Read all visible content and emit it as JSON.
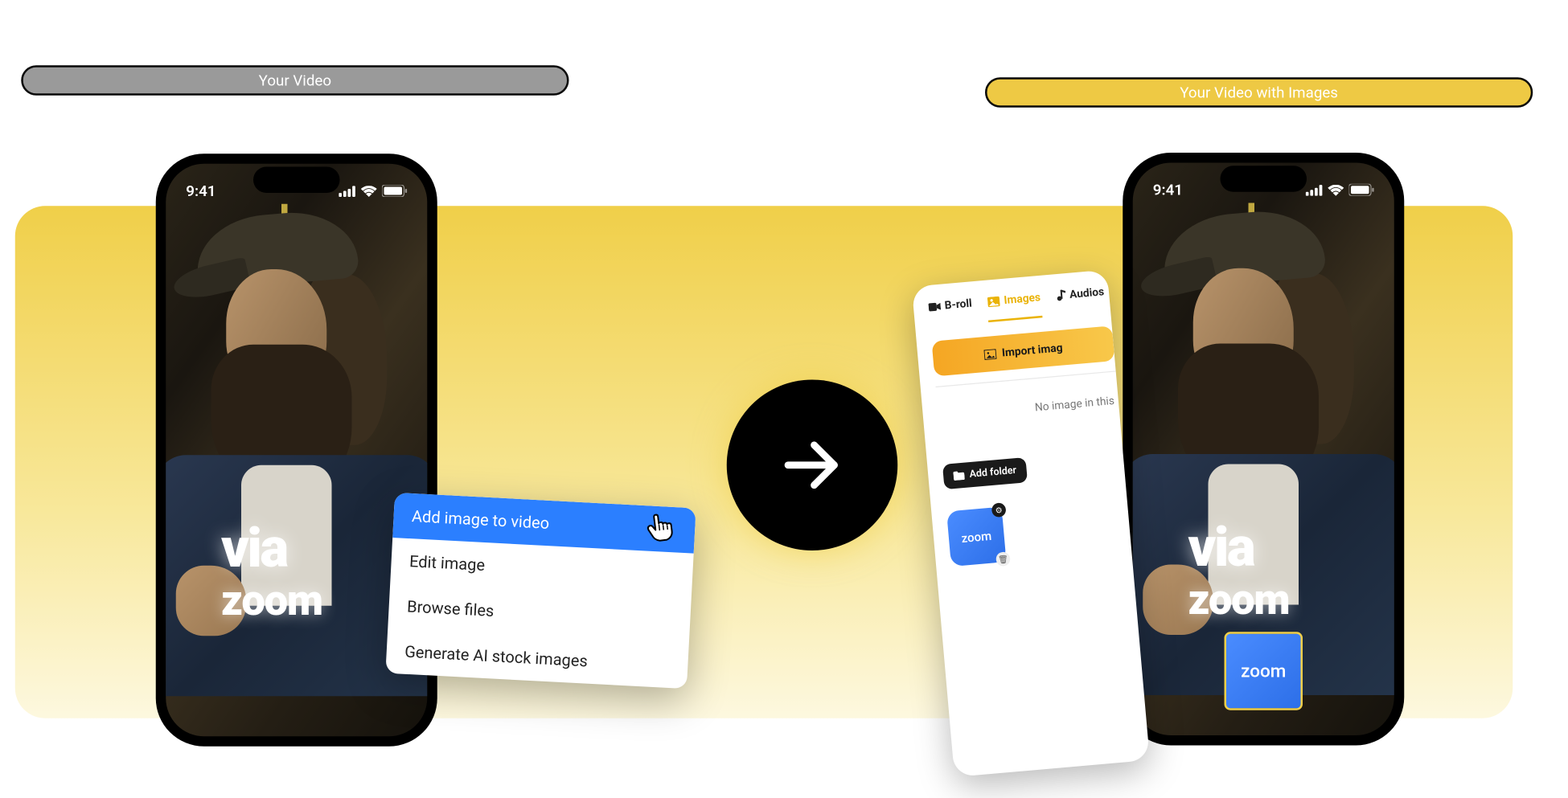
{
  "labels": {
    "left": "Your Video",
    "right": "Your Video with Images"
  },
  "phone": {
    "time": "9:41",
    "overlay_line1": "via",
    "overlay_line2": "zoom",
    "zoom_tile_label": "zoom"
  },
  "context_menu": {
    "items": [
      "Add image to video",
      "Edit image",
      "Browse files",
      "Generate AI stock images"
    ]
  },
  "image_panel": {
    "tabs": {
      "broll": "B-roll",
      "images": "Images",
      "audios": "Audios"
    },
    "import_button": "Import imag",
    "empty_text": "No image in this",
    "add_folder": "Add folder",
    "app_tile": "zoom"
  }
}
